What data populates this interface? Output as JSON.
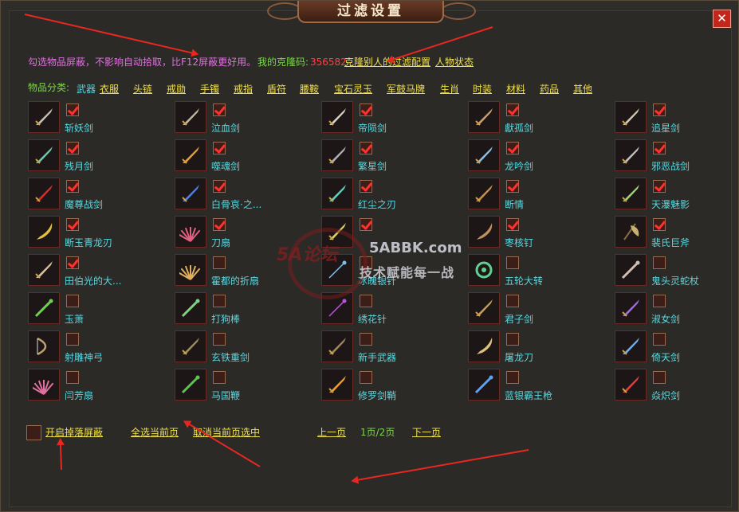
{
  "title": "过滤设置",
  "close_glyph": "✕",
  "info": {
    "hint": "勾选物品屏蔽，不影响自动拾取，比F12屏蔽更好用。",
    "code_label": "我的克隆码:",
    "code_value": "356582",
    "clone_link": "克隆别人的过滤配置",
    "status_link": "人物状态"
  },
  "categories": {
    "label": "物品分类:",
    "items": [
      "武器",
      "衣服",
      "头链",
      "戒勋",
      "手镯",
      "戒指",
      "盾符",
      "腰鞍",
      "宝石灵玉",
      "军鼓马牌",
      "生肖",
      "时装",
      "材料",
      "药品",
      "其他"
    ],
    "active": "武器"
  },
  "items": [
    {
      "name": "斩妖剑",
      "checked": true,
      "icon": "sword-icon",
      "color": "#c8c0b0"
    },
    {
      "name": "泣血剑",
      "checked": true,
      "icon": "sword-icon",
      "color": "#c0b8a0"
    },
    {
      "name": "帝陨剑",
      "checked": true,
      "icon": "sword-icon",
      "color": "#d8d0c0"
    },
    {
      "name": "獻孤剑",
      "checked": true,
      "icon": "sword-icon",
      "color": "#c8a070"
    },
    {
      "name": "追星剑",
      "checked": true,
      "icon": "sword-icon",
      "color": "#d0c8b0"
    },
    {
      "name": "残月剑",
      "checked": true,
      "icon": "sword-icon",
      "color": "#70c8b0"
    },
    {
      "name": "噬魂剑",
      "checked": true,
      "icon": "sword-icon",
      "color": "#e0a040"
    },
    {
      "name": "繁星剑",
      "checked": true,
      "icon": "sword-icon",
      "color": "#b0b0b8"
    },
    {
      "name": "龙吟剑",
      "checked": true,
      "icon": "sword-icon",
      "color": "#90c0e0"
    },
    {
      "name": "邪恶战剑",
      "checked": true,
      "icon": "sword-icon",
      "color": "#c0c0c0"
    },
    {
      "name": "魔尊战剑",
      "checked": true,
      "icon": "sword-icon",
      "color": "#d03030"
    },
    {
      "name": "白骨哀·之...",
      "checked": true,
      "icon": "sword-icon",
      "color": "#5080e0"
    },
    {
      "name": "红尘之刃",
      "checked": true,
      "icon": "sword-icon",
      "color": "#60d0c0"
    },
    {
      "name": "断情",
      "checked": true,
      "icon": "sword-icon",
      "color": "#c89050"
    },
    {
      "name": "天瀑魅影",
      "checked": true,
      "icon": "sword-icon",
      "color": "#a0d080"
    },
    {
      "name": "断玉青龙刃",
      "checked": true,
      "icon": "blade-icon",
      "color": "#e0c040"
    },
    {
      "name": "刀扇",
      "checked": true,
      "icon": "fan-icon",
      "color": "#e06080"
    },
    {
      "name": "",
      "checked": true,
      "icon": "sword-icon",
      "color": "#e0d060"
    },
    {
      "name": "枣核钉",
      "checked": true,
      "icon": "blade-icon",
      "color": "#c09060"
    },
    {
      "name": "裴氏巨斧",
      "checked": true,
      "icon": "axe-icon",
      "color": "#c8b070"
    },
    {
      "name": "田伯光的大...",
      "checked": true,
      "icon": "sword-icon",
      "color": "#d8c0a0"
    },
    {
      "name": "霍都的折扇",
      "checked": false,
      "icon": "fan-icon",
      "color": "#e0b060"
    },
    {
      "name": "冰魄银针",
      "checked": false,
      "icon": "needle-icon",
      "color": "#80c0f0"
    },
    {
      "name": "五轮大转",
      "checked": false,
      "icon": "wheel-icon",
      "color": "#60d090"
    },
    {
      "name": "鬼头灵蛇杖",
      "checked": false,
      "icon": "staff-icon",
      "color": "#d0c0b0"
    },
    {
      "name": "玉萧",
      "checked": false,
      "icon": "flute-icon",
      "color": "#70d050"
    },
    {
      "name": "打狗棒",
      "checked": false,
      "icon": "staff-icon",
      "color": "#80d080"
    },
    {
      "name": "绣花针",
      "checked": false,
      "icon": "needle-icon",
      "color": "#c050e0"
    },
    {
      "name": "君子剑",
      "checked": false,
      "icon": "sword-icon",
      "color": "#c0a060"
    },
    {
      "name": "淑女剑",
      "checked": false,
      "icon": "sword-icon",
      "color": "#a070e0"
    },
    {
      "name": "射雕神弓",
      "checked": false,
      "icon": "bow-icon",
      "color": "#c0a070"
    },
    {
      "name": "玄铁重剑",
      "checked": false,
      "icon": "sword-icon",
      "color": "#a09060"
    },
    {
      "name": "新手武器",
      "checked": false,
      "icon": "sword-icon",
      "color": "#a08860"
    },
    {
      "name": "屠龙刀",
      "checked": false,
      "icon": "blade-icon",
      "color": "#e0c080"
    },
    {
      "name": "倚天剑",
      "checked": false,
      "icon": "sword-icon",
      "color": "#70b0f0"
    },
    {
      "name": "闫芳扇",
      "checked": false,
      "icon": "fan-icon",
      "color": "#e070a0"
    },
    {
      "name": "马国鞭",
      "checked": false,
      "icon": "flute-icon",
      "color": "#60c050"
    },
    {
      "name": "修罗剑鞘",
      "checked": false,
      "icon": "sword-icon",
      "color": "#f0a030"
    },
    {
      "name": "蓝银霸王枪",
      "checked": false,
      "icon": "spear-icon",
      "color": "#60a0f0"
    },
    {
      "name": "焱炽剑",
      "checked": false,
      "icon": "sword-icon",
      "color": "#e04040"
    }
  ],
  "footer": {
    "drop_filter": "开启掉落屏蔽",
    "select_all": "全选当前页",
    "deselect_all": "取消当前页选中",
    "prev": "上一页",
    "page": "1页/2页",
    "next": "下一页"
  },
  "watermark": {
    "logo": "5A论坛",
    "site": "5ABBK.com",
    "slogan": "技术赋能每一战"
  },
  "colors": {
    "checkbox_check": "#ff3030",
    "item_name": "#58d8e0",
    "link": "#f0e04a",
    "annotation_arrow": "#e82820"
  }
}
